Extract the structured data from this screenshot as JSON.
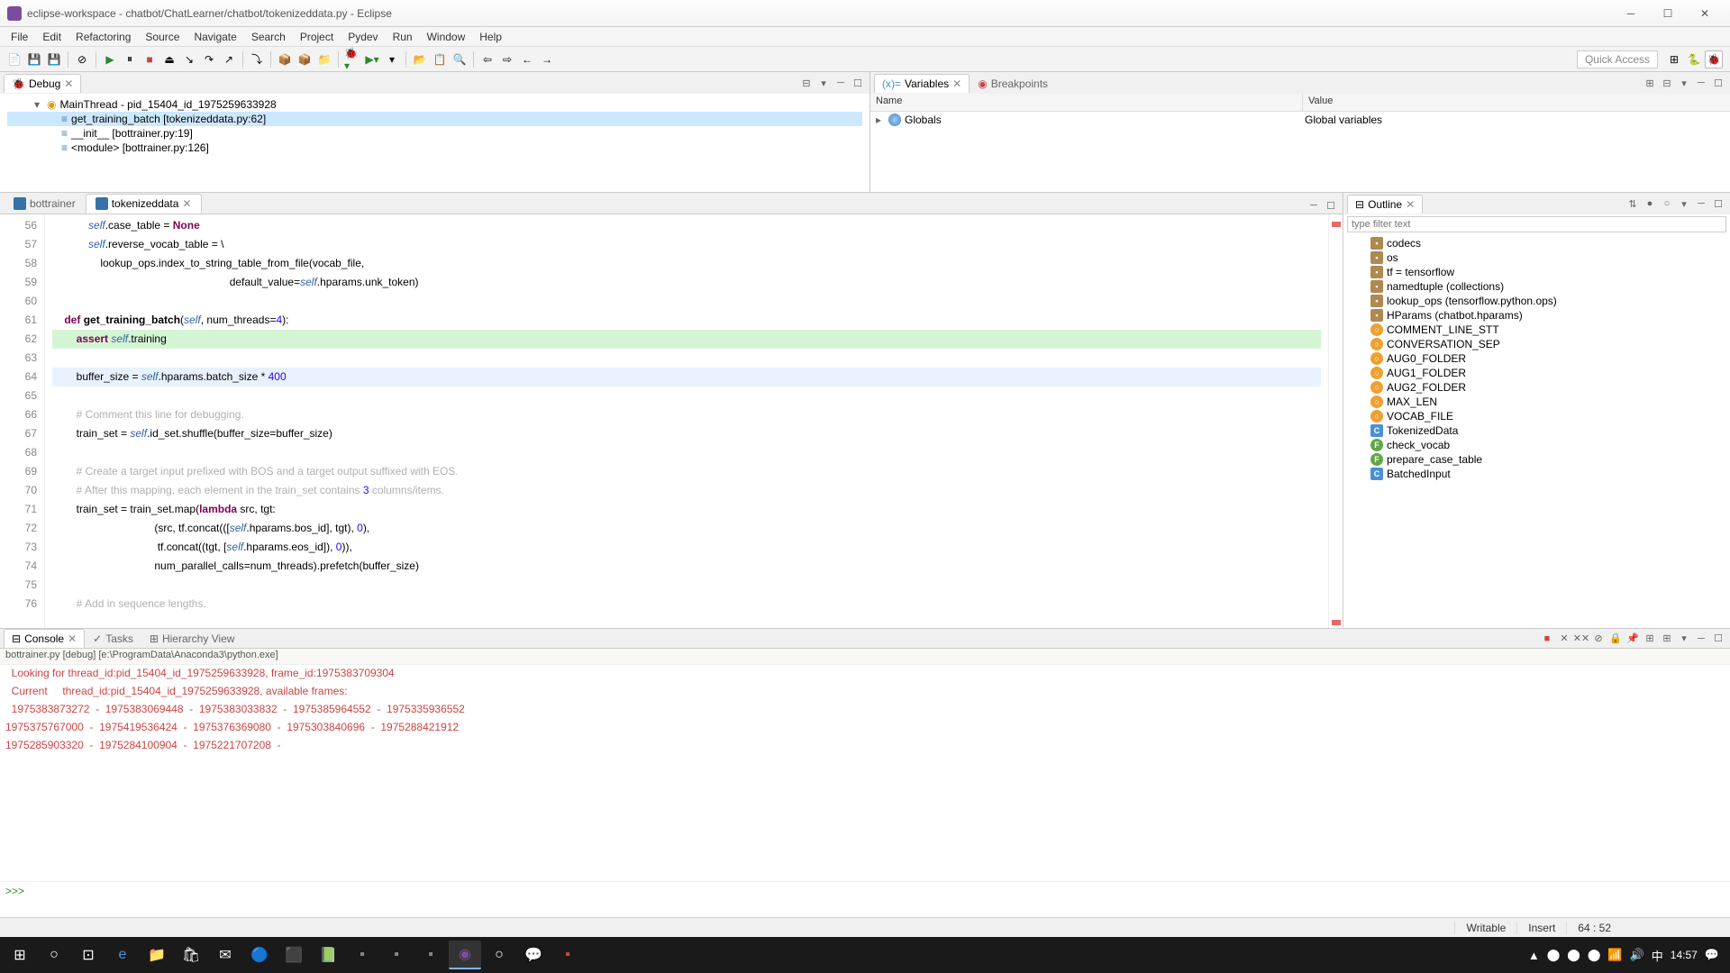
{
  "window": {
    "title": "eclipse-workspace - chatbot/ChatLearner/chatbot/tokenizeddata.py - Eclipse"
  },
  "menubar": [
    "File",
    "Edit",
    "Refactoring",
    "Source",
    "Navigate",
    "Search",
    "Project",
    "Pydev",
    "Run",
    "Window",
    "Help"
  ],
  "quick_access": "Quick Access",
  "debug_view": {
    "title": "Debug",
    "thread": "MainThread - pid_15404_id_1975259633928",
    "frames": [
      "get_training_batch [tokenizeddata.py:62]",
      "__init__ [bottrainer.py:19]",
      "<module> [bottrainer.py:126]"
    ]
  },
  "variables_view": {
    "tab1": "Variables",
    "tab2": "Breakpoints",
    "col_name": "Name",
    "col_value": "Value",
    "globals": "Globals",
    "globals_value": "Global variables"
  },
  "editor": {
    "tabs": [
      "bottrainer",
      "tokenizeddata"
    ],
    "active_tab": 1,
    "lines": [
      {
        "n": 56,
        "text": "            self.case_table = None"
      },
      {
        "n": 57,
        "text": "            self.reverse_vocab_table = \\"
      },
      {
        "n": 58,
        "text": "                lookup_ops.index_to_string_table_from_file(vocab_file,"
      },
      {
        "n": 59,
        "text": "                                                           default_value=self.hparams.unk_token)"
      },
      {
        "n": 60,
        "text": ""
      },
      {
        "n": 61,
        "text": "    def get_training_batch(self, num_threads=4):"
      },
      {
        "n": 62,
        "text": "        assert self.training",
        "exec": true
      },
      {
        "n": 63,
        "text": ""
      },
      {
        "n": 64,
        "text": "        buffer_size = self.hparams.batch_size * 400",
        "hl": true
      },
      {
        "n": 65,
        "text": ""
      },
      {
        "n": 66,
        "text": "        # Comment this line for debugging."
      },
      {
        "n": 67,
        "text": "        train_set = self.id_set.shuffle(buffer_size=buffer_size)"
      },
      {
        "n": 68,
        "text": ""
      },
      {
        "n": 69,
        "text": "        # Create a target input prefixed with BOS and a target output suffixed with EOS."
      },
      {
        "n": 70,
        "text": "        # After this mapping, each element in the train_set contains 3 columns/items."
      },
      {
        "n": 71,
        "text": "        train_set = train_set.map(lambda src, tgt:"
      },
      {
        "n": 72,
        "text": "                                  (src, tf.concat(([self.hparams.bos_id], tgt), 0),"
      },
      {
        "n": 73,
        "text": "                                   tf.concat((tgt, [self.hparams.eos_id]), 0)),"
      },
      {
        "n": 74,
        "text": "                                  num_parallel_calls=num_threads).prefetch(buffer_size)"
      },
      {
        "n": 75,
        "text": ""
      },
      {
        "n": 76,
        "text": "        # Add in sequence lengths."
      }
    ]
  },
  "outline": {
    "title": "Outline",
    "filter_placeholder": "type filter text",
    "items": [
      {
        "kind": "import",
        "label": "codecs"
      },
      {
        "kind": "import",
        "label": "os"
      },
      {
        "kind": "import",
        "label": "tf = tensorflow"
      },
      {
        "kind": "import",
        "label": "namedtuple (collections)"
      },
      {
        "kind": "import",
        "label": "lookup_ops (tensorflow.python.ops)"
      },
      {
        "kind": "import",
        "label": "HParams (chatbot.hparams)"
      },
      {
        "kind": "const",
        "label": "COMMENT_LINE_STT"
      },
      {
        "kind": "const",
        "label": "CONVERSATION_SEP"
      },
      {
        "kind": "const",
        "label": "AUG0_FOLDER"
      },
      {
        "kind": "const",
        "label": "AUG1_FOLDER"
      },
      {
        "kind": "const",
        "label": "AUG2_FOLDER"
      },
      {
        "kind": "const",
        "label": "MAX_LEN"
      },
      {
        "kind": "const",
        "label": "VOCAB_FILE"
      },
      {
        "kind": "class",
        "label": "TokenizedData"
      },
      {
        "kind": "func",
        "label": "check_vocab"
      },
      {
        "kind": "func",
        "label": "prepare_case_table"
      },
      {
        "kind": "class",
        "label": "BatchedInput"
      }
    ]
  },
  "console": {
    "tab1": "Console",
    "tab2": "Tasks",
    "tab3": "Hierarchy View",
    "header": "bottrainer.py [debug] [e:\\ProgramData\\Anaconda3\\python.exe]",
    "lines": [
      "  Looking for thread_id:pid_15404_id_1975259633928, frame_id:1975383709304",
      "  Current     thread_id:pid_15404_id_1975259633928, available frames:",
      "  1975383873272  -  1975383069448  -  1975383033832  -  1975385964552  -  1975335936552",
      "1975375767000  -  1975419536424  -  1975376369080  -  1975303840696  -  1975288421912",
      "1975285903320  -  1975284100904  -  1975221707208  -  "
    ],
    "prompt": ">>> "
  },
  "statusbar": {
    "writable": "Writable",
    "insert": "Insert",
    "pos": "64 : 52"
  },
  "taskbar": {
    "time": "14:57"
  }
}
